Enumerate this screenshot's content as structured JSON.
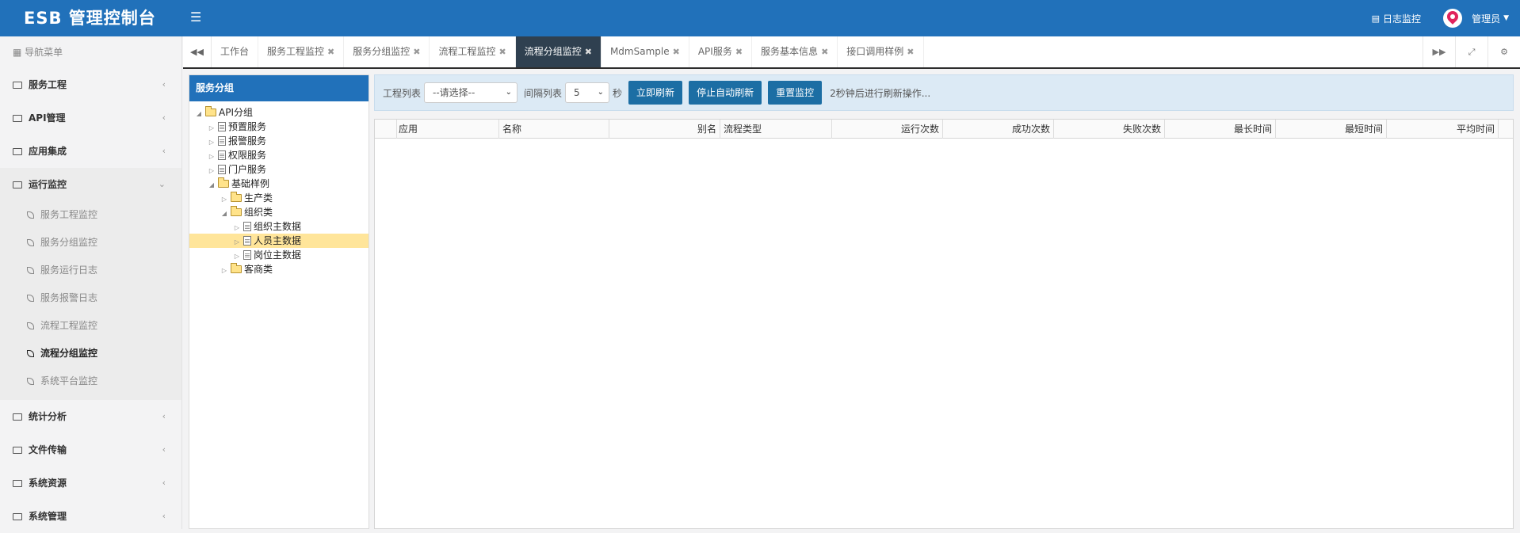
{
  "header": {
    "brand": "ESB 管理控制台",
    "log_monitor": "日志监控",
    "user": "管理员"
  },
  "sidebar": {
    "title": "导航菜单",
    "items_top": [
      {
        "label": "服务工程"
      },
      {
        "label": "API管理"
      },
      {
        "label": "应用集成"
      },
      {
        "label": "运行监控"
      }
    ],
    "sub_items": [
      {
        "label": "服务工程监控"
      },
      {
        "label": "服务分组监控"
      },
      {
        "label": "服务运行日志"
      },
      {
        "label": "服务报警日志"
      },
      {
        "label": "流程工程监控"
      },
      {
        "label": "流程分组监控"
      },
      {
        "label": "系统平台监控"
      }
    ],
    "items_bottom": [
      {
        "label": "统计分析"
      },
      {
        "label": "文件传输"
      },
      {
        "label": "系统资源"
      },
      {
        "label": "系统管理"
      }
    ]
  },
  "tabs": [
    {
      "label": "工作台"
    },
    {
      "label": "服务工程监控"
    },
    {
      "label": "服务分组监控"
    },
    {
      "label": "流程工程监控"
    },
    {
      "label": "流程分组监控"
    },
    {
      "label": "MdmSample"
    },
    {
      "label": "API服务"
    },
    {
      "label": "服务基本信息"
    },
    {
      "label": "接口调用样例"
    }
  ],
  "tree_panel": {
    "title": "服务分组",
    "nodes": [
      {
        "label": "API分组"
      },
      {
        "label": "预置服务"
      },
      {
        "label": "报警服务"
      },
      {
        "label": "权限服务"
      },
      {
        "label": "门户服务"
      },
      {
        "label": "基础样例"
      },
      {
        "label": "生产类"
      },
      {
        "label": "组织类"
      },
      {
        "label": "组织主数据"
      },
      {
        "label": "人员主数据"
      },
      {
        "label": "岗位主数据"
      },
      {
        "label": "客商类"
      }
    ]
  },
  "toolbar": {
    "project_label": "工程列表",
    "project_select": "--请选择--",
    "interval_label": "间隔列表",
    "interval_value": "5",
    "interval_unit": "秒",
    "refresh_now": "立即刷新",
    "stop_auto": "停止自动刷新",
    "reset": "重置监控",
    "status": "2秒钟后进行刷新操作..."
  },
  "grid": {
    "columns": [
      "应用",
      "名称",
      "别名",
      "流程类型",
      "运行次数",
      "成功次数",
      "失败次数",
      "最长时间",
      "最短时间",
      "平均时间"
    ]
  }
}
